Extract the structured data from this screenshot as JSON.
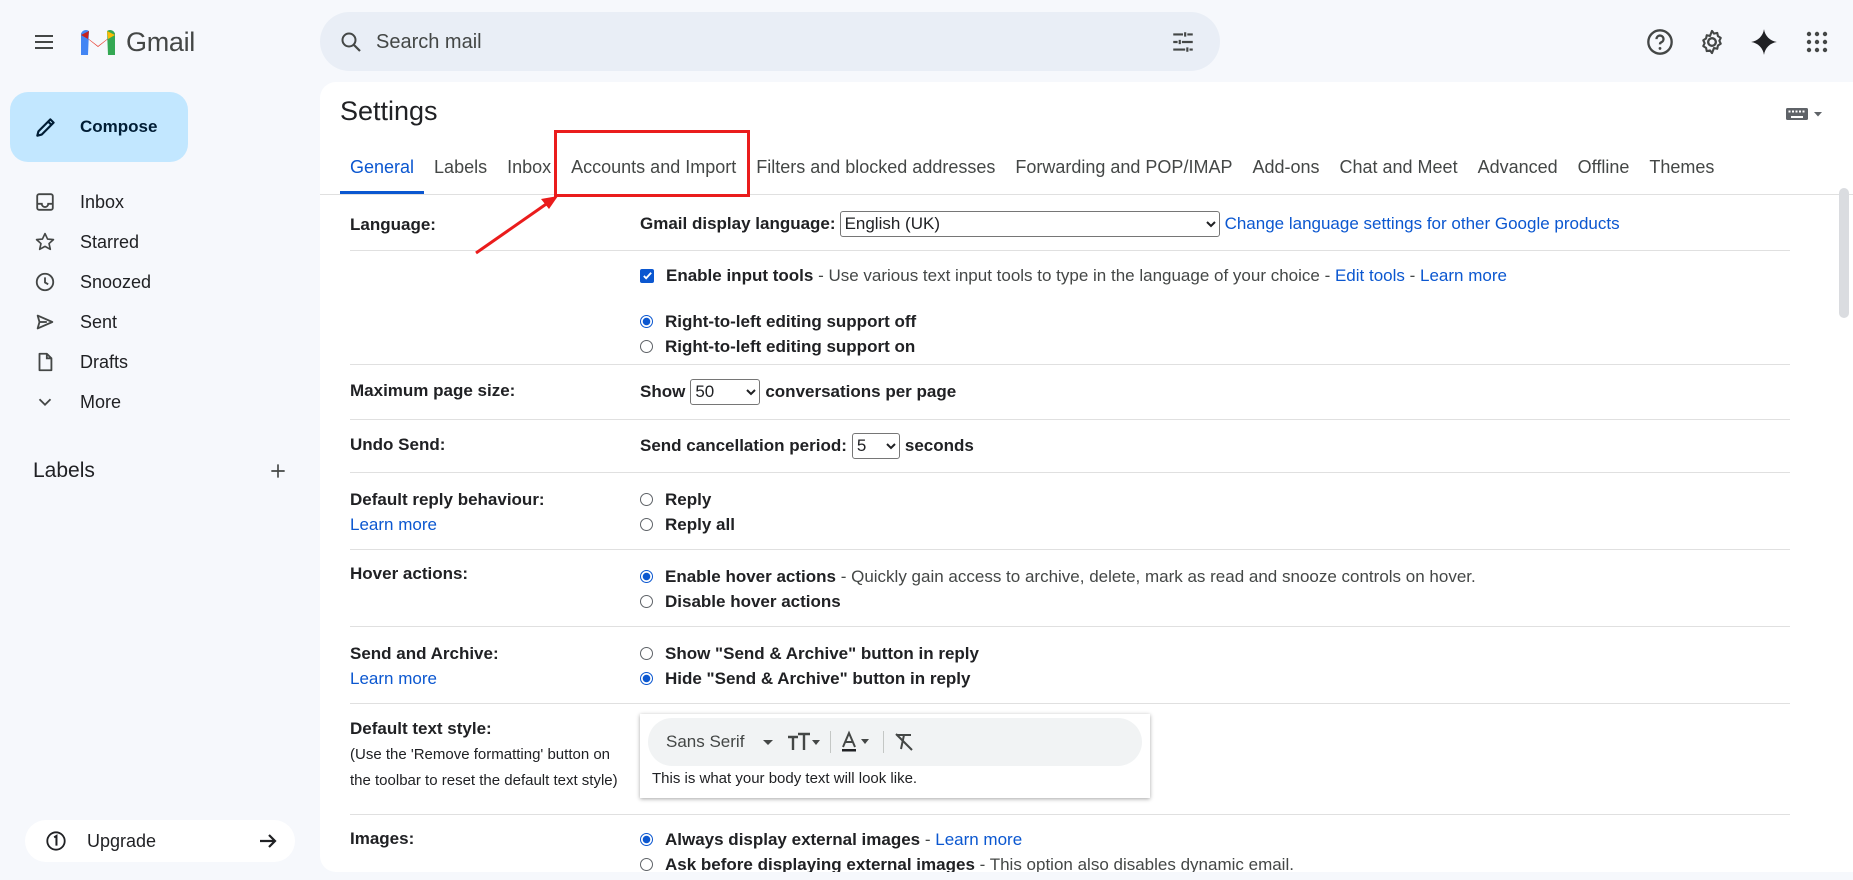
{
  "app": {
    "brand": "Gmail",
    "search_placeholder": "Search mail"
  },
  "sidebar": {
    "compose_label": "Compose",
    "items": [
      {
        "label": "Inbox",
        "icon": "inbox-icon"
      },
      {
        "label": "Starred",
        "icon": "star-icon"
      },
      {
        "label": "Snoozed",
        "icon": "clock-icon"
      },
      {
        "label": "Sent",
        "icon": "send-icon"
      },
      {
        "label": "Drafts",
        "icon": "draft-icon"
      },
      {
        "label": "More",
        "icon": "chevron-down-icon"
      }
    ],
    "labels_heading": "Labels",
    "upgrade_label": "Upgrade"
  },
  "settings": {
    "title": "Settings",
    "tabs": [
      {
        "label": "General",
        "active": true
      },
      {
        "label": "Labels"
      },
      {
        "label": "Inbox"
      },
      {
        "label": "Accounts and Import"
      },
      {
        "label": "Filters and blocked addresses"
      },
      {
        "label": "Forwarding and POP/IMAP"
      },
      {
        "label": "Add-ons"
      },
      {
        "label": "Chat and Meet"
      },
      {
        "label": "Advanced"
      },
      {
        "label": "Offline"
      },
      {
        "label": "Themes"
      }
    ],
    "language": {
      "label": "Language:",
      "display_label": "Gmail display language:",
      "selected": "English (UK)",
      "change_link": "Change language settings for other Google products",
      "input_tools_label": "Enable input tools",
      "input_tools_desc": " - Use various text input tools to type in the language of your choice - ",
      "edit_tools": "Edit tools",
      "dash": " - ",
      "learn_more": "Learn more",
      "rtl_off": "Right-to-left editing support off",
      "rtl_on": "Right-to-left editing support on"
    },
    "page_size": {
      "label": "Maximum page size:",
      "show": "Show",
      "value": "50",
      "suffix": "conversations per page"
    },
    "undo_send": {
      "label": "Undo Send:",
      "prefix": "Send cancellation period:",
      "value": "5",
      "suffix": "seconds"
    },
    "reply": {
      "label": "Default reply behaviour:",
      "learn_more": "Learn more",
      "opt1": "Reply",
      "opt2": "Reply all"
    },
    "hover": {
      "label": "Hover actions:",
      "opt1": "Enable hover actions",
      "opt1_desc": " - Quickly gain access to archive, delete, mark as read and snooze controls on hover.",
      "opt2": "Disable hover actions"
    },
    "send_archive": {
      "label": "Send and Archive:",
      "learn_more": "Learn more",
      "opt1": "Show \"Send & Archive\" button in reply",
      "opt2": "Hide \"Send & Archive\" button in reply"
    },
    "text_style": {
      "label": "Default text style:",
      "note": "(Use the 'Remove formatting' button on the toolbar to reset the default text style)",
      "font": "Sans Serif",
      "sample": "This is what your body text will look like."
    },
    "images": {
      "label": "Images:",
      "opt1": "Always display external images",
      "dash": " - ",
      "learn_more": "Learn more",
      "opt2": "Ask before displaying external images",
      "opt2_desc": " - This option also disables dynamic email."
    }
  },
  "colors": {
    "accent": "#0b57d0",
    "compose_bg": "#c2e7ff",
    "highlight": "#ea1c1c"
  }
}
